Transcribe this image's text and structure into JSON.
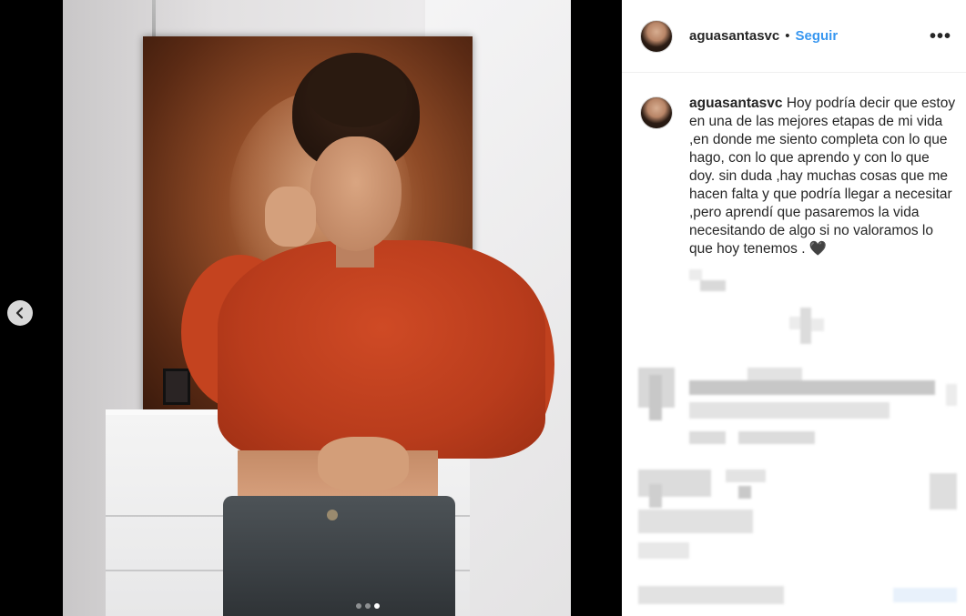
{
  "post": {
    "username": "aguasantasvc",
    "separator": "•",
    "follow_label": "Seguir",
    "more_icon": "more-options-icon",
    "more_glyph": "•••",
    "caption": "Hoy podría decir que estoy en una de las mejores etapas de mi vida ,en donde me siento completa con lo que hago, con lo que aprendo y con lo que doy. sin duda ,hay muchas cosas que me hacen falta y que podría llegar a necesitar ,pero aprendí que pasaremos la vida necesitando de algo si no valoramos lo que hoy tenemos .",
    "caption_emoji": "🖤"
  },
  "media": {
    "carousel_total": 3,
    "carousel_active_index": 3,
    "prev_icon": "chevron-left-icon",
    "prev_glyph": "‹"
  },
  "colors": {
    "accent": "#3897f0",
    "sweater": "#c4431f"
  }
}
